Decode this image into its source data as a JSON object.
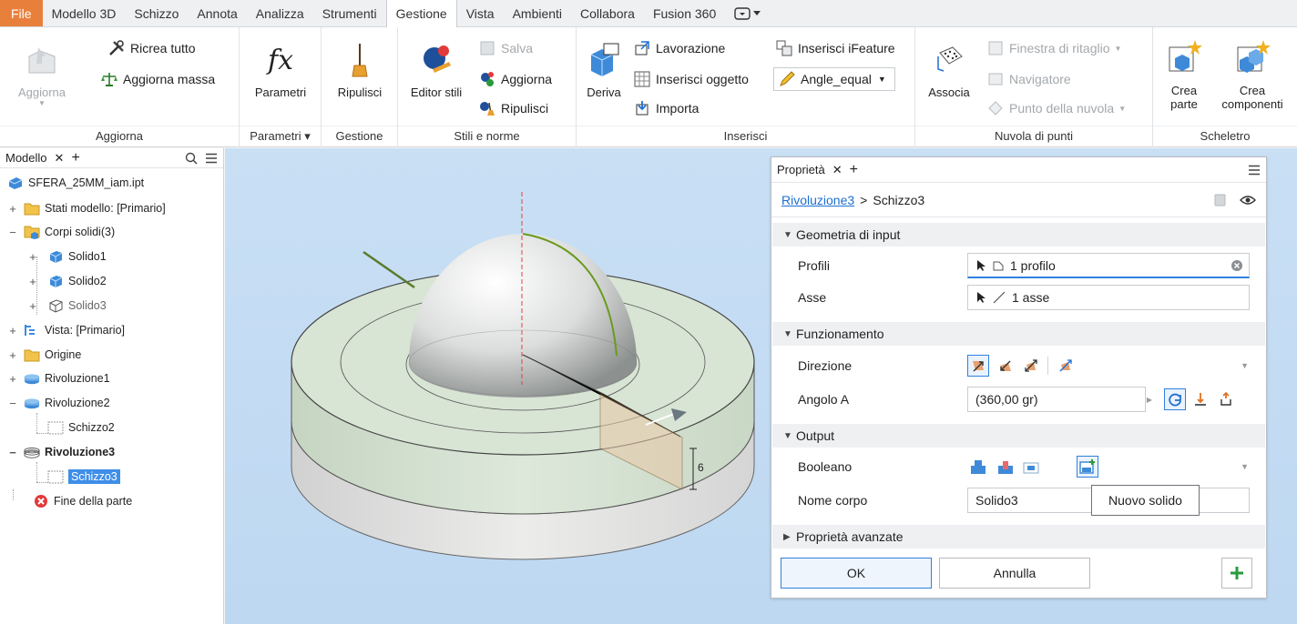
{
  "menu": {
    "file": "File",
    "tabs": [
      "Modello 3D",
      "Schizzo",
      "Annota",
      "Analizza",
      "Strumenti",
      "Gestione",
      "Vista",
      "Ambienti",
      "Collabora",
      "Fusion 360"
    ],
    "active_tab": "Gestione"
  },
  "ribbon": {
    "aggiorna": {
      "big": "Aggiorna",
      "ricrea": "Ricrea tutto",
      "massa": "Aggiorna massa",
      "title": "Aggiorna"
    },
    "parametri": {
      "big": "Parametri",
      "title": "Parametri"
    },
    "gestione": {
      "big": "Ripulisci",
      "title": "Gestione"
    },
    "stili": {
      "editor": "Editor stili",
      "salva": "Salva",
      "aggiorna": "Aggiorna",
      "ripulisci": "Ripulisci",
      "title": "Stili e norme"
    },
    "inserisci": {
      "deriva": "Deriva",
      "lavorazione": "Lavorazione",
      "oggetto": "Inserisci oggetto",
      "importa": "Importa",
      "ifeature": "Inserisci iFeature",
      "angle": "Angle_equal",
      "title": "Inserisci"
    },
    "nuvola": {
      "associa": "Associa",
      "finestra": "Finestra di ritaglio",
      "navigatore": "Navigatore",
      "punto": "Punto della nuvola",
      "title": "Nuvola di punti"
    },
    "scheletro": {
      "parte1": "Crea",
      "parte2": "parte",
      "comp1": "Crea",
      "comp2": "componenti",
      "title": "Scheletro"
    }
  },
  "browser": {
    "tab": "Modello",
    "items": [
      {
        "label": "SFERA_25MM_iam.ipt"
      },
      {
        "label": "Stati modello: [Primario]"
      },
      {
        "label": "Corpi solidi(3)"
      },
      {
        "label": "Solido1"
      },
      {
        "label": "Solido2"
      },
      {
        "label": "Solido3"
      },
      {
        "label": "Vista: [Primario]"
      },
      {
        "label": "Origine"
      },
      {
        "label": "Rivoluzione1"
      },
      {
        "label": "Rivoluzione2"
      },
      {
        "label": "Schizzo2"
      },
      {
        "label": "Rivoluzione3"
      },
      {
        "label": "Schizzo3"
      },
      {
        "label": "Fine della parte"
      }
    ]
  },
  "viewport": {
    "dimension": "6"
  },
  "props": {
    "tab": "Proprietà",
    "crumb_parent": "Rivoluzione3",
    "crumb_sep": ">",
    "crumb_child": "Schizzo3",
    "sec_input": "Geometria di input",
    "profili_label": "Profili",
    "profili_value": "1 profilo",
    "asse_label": "Asse",
    "asse_value": "1 asse",
    "sec_funz": "Funzionamento",
    "direzione_label": "Direzione",
    "angolo_label": "Angolo A",
    "angolo_value": "(360,00 gr)",
    "sec_output": "Output",
    "booleano_label": "Booleano",
    "nome_label": "Nome corpo",
    "nome_value": "Solido3",
    "tooltip": "Nuovo solido",
    "sec_avanzate": "Proprietà avanzate",
    "ok": "OK",
    "annulla": "Annulla"
  },
  "colors": {
    "accent": "#2f80e0",
    "file_tab": "#e8803c",
    "viewport_bg": "#c6ddf3",
    "selection": "#3f8ee8"
  }
}
